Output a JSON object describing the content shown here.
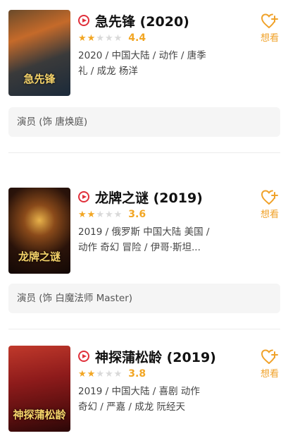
{
  "movies": [
    {
      "title": "急先锋 (2020)",
      "score": "4.4",
      "stars_on": 2,
      "meta_line1": "2020 / 中国大陆 / 动作 / 唐季",
      "meta_line2": "礼 / 成龙 杨洋",
      "want_label": "想看",
      "actor": "演员 (饰 唐焕庭)",
      "poster_title": "急先锋"
    },
    {
      "title": "龙牌之谜 (2019)",
      "score": "3.6",
      "stars_on": 2,
      "meta_line1": "2019 / 俄罗斯 中国大陆 美国 /",
      "meta_line2": "动作 奇幻 冒险 / 伊哥·斯坦...",
      "want_label": "想看",
      "actor": "演员 (饰 白魔法师  Master)",
      "poster_title": "龙牌之谜"
    },
    {
      "title": "神探蒲松龄 (2019)",
      "score": "3.8",
      "stars_on": 2,
      "meta_line1": "2019 / 中国大陆 / 喜剧 动作",
      "meta_line2": "奇幻 / 严嘉 / 成龙 阮经天",
      "want_label": "想看",
      "poster_title": "神探蒲松龄"
    }
  ],
  "colors": {
    "accent": "#f2a623",
    "play": "#e0303b"
  }
}
